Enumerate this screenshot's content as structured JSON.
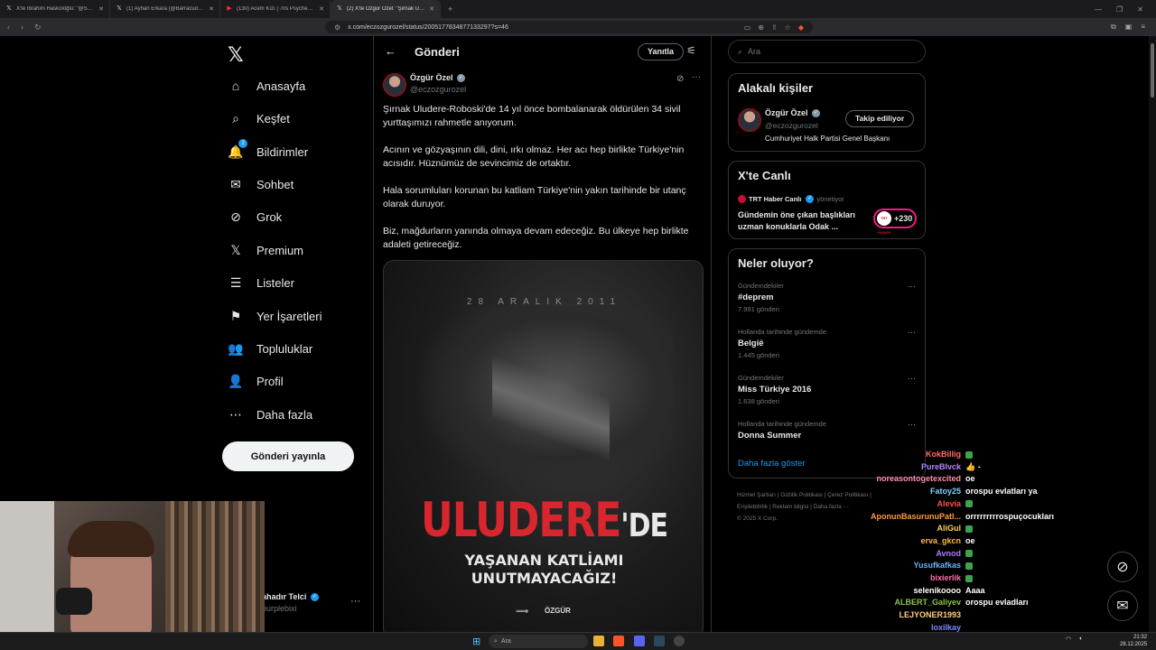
{
  "browser": {
    "tabs": [
      {
        "label": "X'te İbrahim Haskoloğlu: \"@SONI",
        "icon": "x-icon",
        "active": false
      },
      {
        "label": "(1) Ayhan Erkara (@BarracudaVol1) /",
        "icon": "x-icon",
        "active": false
      },
      {
        "label": "(130) Acem Kızı | 70s Psychedelic Ar",
        "icon": "youtube-icon",
        "active": false
      },
      {
        "label": "(2) X'te Özgür Özel: \"Şırnak Ulud",
        "icon": "x-icon",
        "active": true
      }
    ],
    "new_tab": "+",
    "url": "x.com/eczozgurozel/status/2005177834877133297?s=46"
  },
  "nav": {
    "items": [
      {
        "label": "Anasayfa",
        "icon": "home-icon",
        "glyph": "⌂"
      },
      {
        "label": "Keşfet",
        "icon": "search-icon",
        "glyph": "⌕"
      },
      {
        "label": "Bildirimler",
        "icon": "bell-icon",
        "glyph": "🔔",
        "badge": "2"
      },
      {
        "label": "Sohbet",
        "icon": "mail-icon",
        "glyph": "✉"
      },
      {
        "label": "Grok",
        "icon": "grok-icon",
        "glyph": "⊘"
      },
      {
        "label": "Premium",
        "icon": "x-premium-icon",
        "glyph": "𝕏"
      },
      {
        "label": "Listeler",
        "icon": "list-icon",
        "glyph": "☰"
      },
      {
        "label": "Yer İşaretleri",
        "icon": "bookmark-icon",
        "glyph": "⚑"
      },
      {
        "label": "Topluluklar",
        "icon": "communities-icon",
        "glyph": "👥"
      },
      {
        "label": "Profil",
        "icon": "profile-icon",
        "glyph": "👤"
      },
      {
        "label": "Daha fazla",
        "icon": "more-circle-icon",
        "glyph": "⋯"
      }
    ],
    "post_button": "Gönderi yayınla",
    "account": {
      "name": "ahadır Telci",
      "handle": "purplebixi"
    }
  },
  "post": {
    "header_title": "Gönderi",
    "reply_button": "Yanıtla",
    "author_name": "Özgür Özel",
    "author_handle": "@eczozgurozel",
    "paragraphs": [
      "Şırnak Uludere-Roboski'de 14 yıl önce bombalanarak öldürülen 34 sivil yurttaşımızı rahmetle anıyorum.",
      "Acının ve gözyaşının dili, dini, ırkı olmaz. Her acı hep birlikte Türkiye'nin acısıdır. Hüznümüz de sevincimiz de ortaktır.",
      "Hala sorumluları korunan bu katliam Türkiye'nin yakın tarihinde bir utanç olarak duruyor.",
      "Biz, mağdurların yanında olmaya devam edeceğiz. Bu ülkeye hep birlikte adaleti getireceğiz."
    ],
    "image": {
      "date": "28 ARALIK 2011",
      "title_red": "ULUDERE",
      "title_suffix": "'DE",
      "subtitle_line1": "YAŞANAN KATLİAMI",
      "subtitle_line2": "UNUTMAYACAĞIZ!",
      "logo_text": "ÖZGÜR"
    }
  },
  "sidebar": {
    "search_placeholder": "Ara",
    "related": {
      "title": "Alakalı kişiler",
      "name": "Özgür Özel",
      "handle": "@eczozgurozel",
      "bio": "Cumhuriyet Halk Partisi Genel Başkanı",
      "follow_label": "Takip ediliyor"
    },
    "live": {
      "title": "X'te Canlı",
      "source": "TRT Haber Canlı",
      "role": "yönetiyor",
      "text": "Gündemin öne çıkan başlıkları uzman konuklarla Odak ...",
      "count": "+230",
      "logo": "TRT HABER"
    },
    "trends": {
      "title": "Neler oluyor?",
      "items": [
        {
          "category": "Gündemdekiler",
          "name": "#deprem",
          "count": "7.991 gönderi"
        },
        {
          "category": "Hollanda tarihinde gündemde",
          "name": "België",
          "count": "1.445 gönderi"
        },
        {
          "category": "Gündemdekiler",
          "name": "Miss Türkiye 2016",
          "count": "1.638 gönderi"
        },
        {
          "category": "Hollanda tarihinde gündemde",
          "name": "Donna Summer",
          "count": ""
        }
      ],
      "show_more": "Daha fazla göster"
    },
    "footer": {
      "line1": "Hizmet Şartları  |  Gizlilik Politikası  |  Çerez Politikası  |",
      "line2": "Erişilebilirlik  |  Reklam bilgisi  |  Daha fazla ···",
      "line3": "© 2025 X Corp."
    }
  },
  "chat": [
    {
      "user": "KokBillig",
      "color": "#ff6b6b",
      "msg": "",
      "emote": true
    },
    {
      "user": "PureBlvck",
      "color": "#b388ff",
      "msg": "👍 -",
      "emote": false
    },
    {
      "user": "noreasontogetexcited",
      "color": "#ff8fab",
      "msg": "oe",
      "emote": false
    },
    {
      "user": "Fatoy25",
      "color": "#7fd3ff",
      "msg": "orospu evlatları ya",
      "emote": false
    },
    {
      "user": "Alevia",
      "color": "#ff4d4d",
      "msg": "",
      "emote": true
    },
    {
      "user": "AponunBasurunuPatl...",
      "color": "#ff9a3c",
      "msg": "orrrrrrrrrospuçocukları",
      "emote": false
    },
    {
      "user": "AliGul",
      "color": "#ffd54f",
      "msg": "",
      "emote": true
    },
    {
      "user": "erva_gkcn",
      "color": "#ffb74d",
      "msg": "oe",
      "emote": false
    },
    {
      "user": "Avnod",
      "color": "#a97bff",
      "msg": "",
      "emote": true
    },
    {
      "user": "Yusufkafkas",
      "color": "#64b5f6",
      "msg": "",
      "emote": true
    },
    {
      "user": "bixierlik",
      "color": "#ff6fa8",
      "msg": "",
      "emote": true
    },
    {
      "user": "selenikoooo",
      "color": "#ffffff",
      "msg": "Aaaa",
      "emote": false
    },
    {
      "user": "ALBERT_Galiyev",
      "color": "#8bc34a",
      "msg": "orospu evladları",
      "emote": false
    },
    {
      "user": "LEJYONER1993",
      "color": "#ffd180",
      "msg": "",
      "emote": false
    },
    {
      "user": "loxilkay",
      "color": "#7c8cff",
      "msg": "",
      "emote": false
    }
  ],
  "taskbar": {
    "search": "Ara",
    "time": "21:32",
    "date": "28.12.2025"
  },
  "colors": {
    "accent": "#1d9bf0",
    "red": "#d8262e",
    "background": "#000000",
    "border": "#2f3336"
  }
}
